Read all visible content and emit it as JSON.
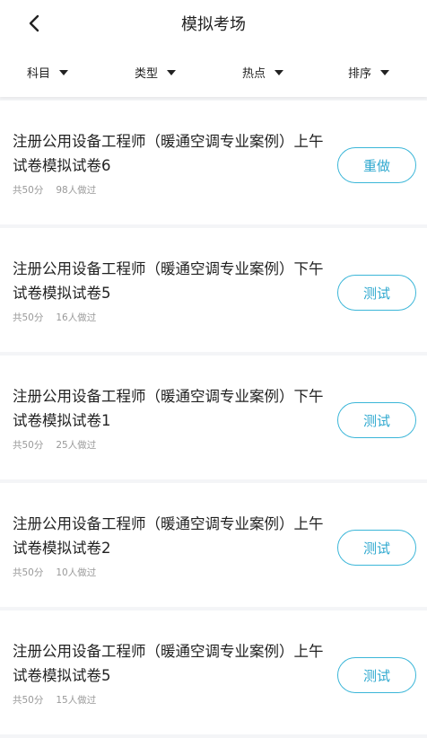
{
  "header": {
    "title": "模拟考场",
    "back_icon": "chevron-left-icon"
  },
  "filters": [
    {
      "label": "科目",
      "icon": "caret-down-icon"
    },
    {
      "label": "类型",
      "icon": "caret-down-icon"
    },
    {
      "label": "热点",
      "icon": "caret-down-icon"
    },
    {
      "label": "排序",
      "icon": "caret-down-icon"
    }
  ],
  "colors": {
    "accent": "#2ea8cf",
    "border_accent": "#3bb6d8",
    "muted": "#999999",
    "background": "#f4f5f7"
  },
  "exams": [
    {
      "title": "注册公用设备工程师（暖通空调专业案例）上午试卷模拟试卷6",
      "score": "共50分",
      "count": "98人做过",
      "action": "重做"
    },
    {
      "title": "注册公用设备工程师（暖通空调专业案例）下午试卷模拟试卷5",
      "score": "共50分",
      "count": "16人做过",
      "action": "测试"
    },
    {
      "title": "注册公用设备工程师（暖通空调专业案例）下午试卷模拟试卷1",
      "score": "共50分",
      "count": "25人做过",
      "action": "测试"
    },
    {
      "title": "注册公用设备工程师（暖通空调专业案例）上午试卷模拟试卷2",
      "score": "共50分",
      "count": "10人做过",
      "action": "测试"
    },
    {
      "title": "注册公用设备工程师（暖通空调专业案例）上午试卷模拟试卷5",
      "score": "共50分",
      "count": "15人做过",
      "action": "测试"
    }
  ]
}
